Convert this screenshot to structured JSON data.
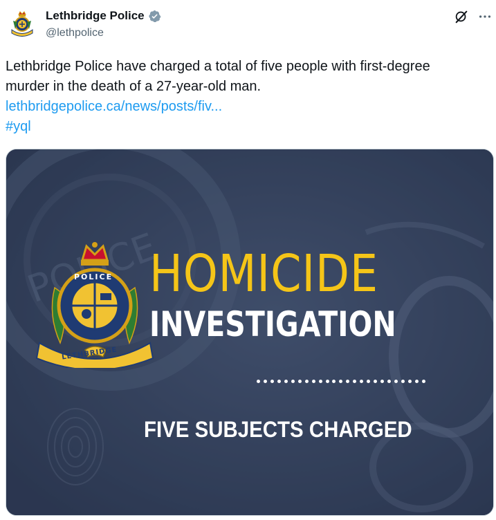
{
  "post": {
    "display_name": "Lethbridge Police",
    "handle": "@lethpolice",
    "text_line_1": "Lethbridge Police have charged a total of five people with first-degree",
    "text_line_2": "murder in the death of a 27-year-old man.",
    "link": "lethbridgepolice.ca/news/posts/fiv...",
    "hashtag": "#yql"
  },
  "icons": {
    "avatar": "police-crest-icon",
    "verified": "verified-badge-icon",
    "grok": "grok-icon",
    "more": "more-options-icon"
  },
  "media": {
    "headline_1": "HOMICIDE",
    "headline_2": "INVESTIGATION",
    "subhead": "FIVE SUBJECTS CHARGED",
    "crest_top": "POLICE",
    "crest_bottom": "LETHBRIDGE"
  },
  "colors": {
    "accent": "#1d9bf0",
    "headline_yellow": "#f5c518",
    "media_bg": "#32405a",
    "verified": "#829aab"
  }
}
